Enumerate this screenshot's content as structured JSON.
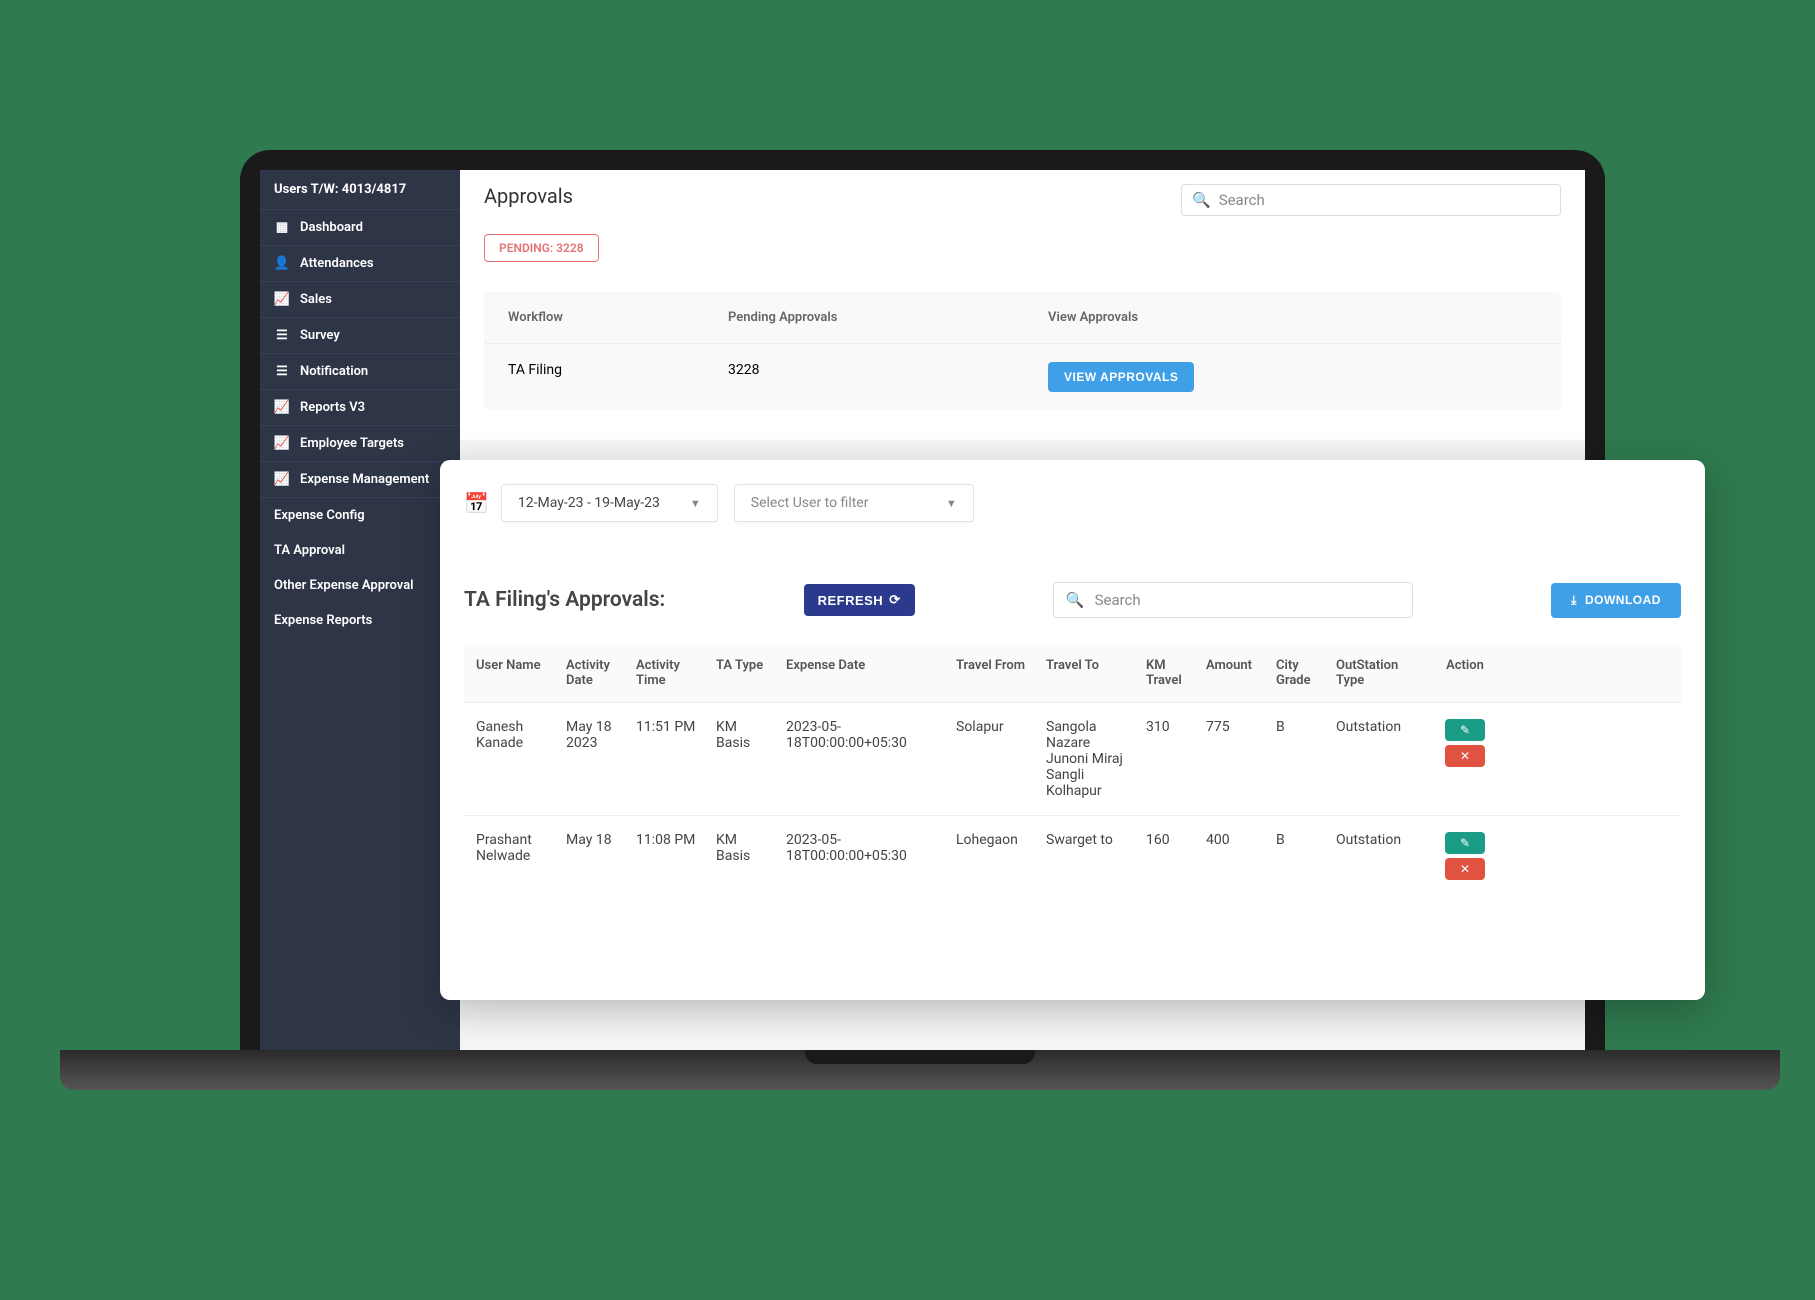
{
  "sidebar": {
    "header": "Users T/W: 4013/4817",
    "items": [
      {
        "label": "Dashboard"
      },
      {
        "label": "Attendances"
      },
      {
        "label": "Sales"
      },
      {
        "label": "Survey"
      },
      {
        "label": "Notification"
      },
      {
        "label": "Reports V3"
      },
      {
        "label": "Employee Targets"
      },
      {
        "label": "Expense Management"
      }
    ],
    "sub_items": [
      {
        "label": "Expense Config"
      },
      {
        "label": "TA Approval"
      },
      {
        "label": "Other Expense Approval"
      },
      {
        "label": "Expense Reports"
      }
    ]
  },
  "approvals": {
    "title": "Approvals",
    "search_placeholder": "Search",
    "pending_badge": "PENDING: 3228",
    "columns": {
      "workflow": "Workflow",
      "pending": "Pending Approvals",
      "view": "View Approvals"
    },
    "row": {
      "workflow": "TA Filing",
      "pending": "3228",
      "view_btn": "VIEW APPROVALS"
    }
  },
  "panel": {
    "date_range": "12-May-23 - 19-May-23",
    "user_filter_placeholder": "Select User to filter",
    "title": "TA Filing's Approvals:",
    "refresh": "REFRESH",
    "search_placeholder": "Search",
    "download": "DOWNLOAD",
    "columns": [
      "User Name",
      "Activity Date",
      "Activity Time",
      "TA Type",
      "Expense Date",
      "Travel From",
      "Travel To",
      "KM Travel",
      "Amount",
      "City Grade",
      "OutStation Type",
      "Action"
    ],
    "rows": [
      {
        "user_name": "Ganesh Kanade",
        "activity_date": "May 18 2023",
        "activity_time": "11:51 PM",
        "ta_type": "KM Basis",
        "expense_date": "2023-05-18T00:00:00+05:30",
        "travel_from": "Solapur",
        "travel_to": "Sangola Nazare Junoni Miraj Sangli Kolhapur",
        "km_travel": "310",
        "amount": "775",
        "city_grade": "B",
        "outstation_type": "Outstation"
      },
      {
        "user_name": "Prashant Nelwade",
        "activity_date": "May 18",
        "activity_time": "11:08 PM",
        "ta_type": "KM Basis",
        "expense_date": "2023-05-18T00:00:00+05:30",
        "travel_from": "Lohegaon",
        "travel_to": "Swarget to",
        "km_travel": "160",
        "amount": "400",
        "city_grade": "B",
        "outstation_type": "Outstation"
      }
    ]
  }
}
